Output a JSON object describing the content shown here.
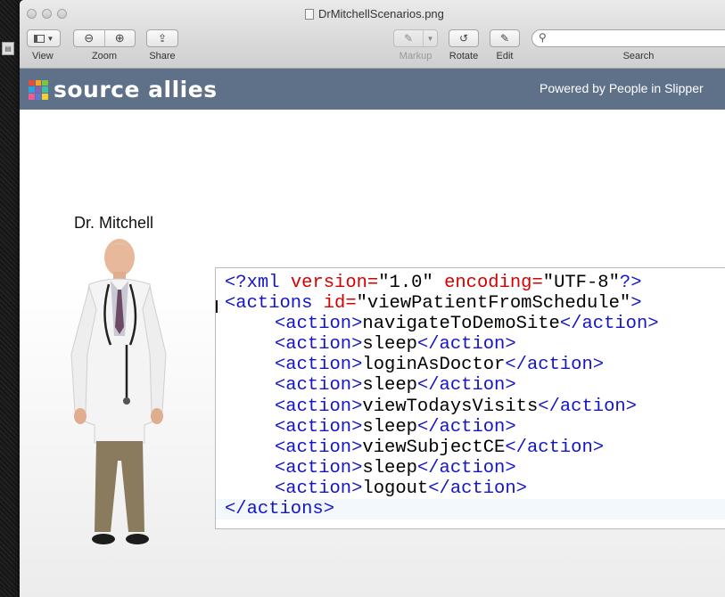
{
  "window": {
    "title": "DrMitchellScenarios.png"
  },
  "toolbar": {
    "view_label": "View",
    "zoom_label": "Zoom",
    "share_label": "Share",
    "markup_label": "Markup",
    "rotate_label": "Rotate",
    "edit_label": "Edit",
    "search_label": "Search",
    "search_placeholder": ""
  },
  "banner": {
    "logo_text": "source allies",
    "tagline": "Powered by People in Slipper"
  },
  "doctor": {
    "name": "Dr. Mitchell"
  },
  "code": {
    "decl_open": "<?xml ",
    "decl_version_attr": "version=",
    "decl_version_val": "\"1.0\"",
    "decl_encoding_attr": "encoding=",
    "decl_encoding_val": "\"UTF-8\"",
    "decl_close": "?>",
    "root_open": "<actions ",
    "root_id_attr": "id=",
    "root_id_val": "\"viewPatientFromSchedule\"",
    "root_open_close": ">",
    "action_open": "<action>",
    "action_close": "</action>",
    "actions": [
      "navigateToDemoSite",
      "sleep",
      "loginAsDoctor",
      "sleep",
      "viewTodaysVisits",
      "sleep",
      "viewSubjectCE",
      "sleep",
      "logout"
    ],
    "root_close": "</actions>"
  },
  "colors": {
    "banner": "#5f7189",
    "xml_tag": "#1414c8",
    "xml_attr": "#d40000",
    "logo_squares": [
      "#e94b3c",
      "#f6a623",
      "#7cc243",
      "#2aa3df",
      "#8e5fb5",
      "#3bbfa7",
      "#f05a9b",
      "#5b7bd5",
      "#f2d12e"
    ]
  }
}
